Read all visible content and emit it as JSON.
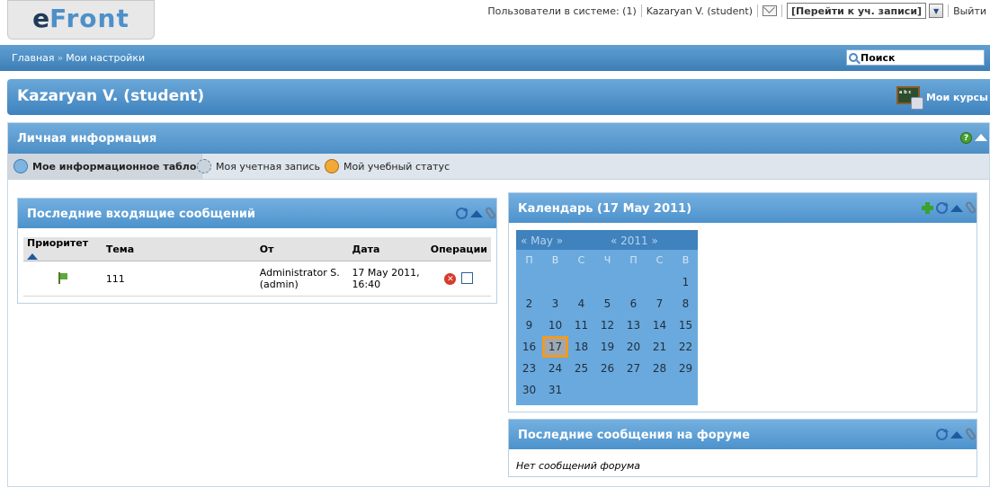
{
  "logo": {
    "e": "e",
    "front": "Front"
  },
  "topbar": {
    "users_online": "Пользователи в системе: (1)",
    "user": "Kazaryan V. (student)",
    "goto": "[Перейти к уч. записи]",
    "logout": "Выйти"
  },
  "navbar": {
    "home": "Главная",
    "arrow": "»",
    "settings": "Мои настройки",
    "search": "Поиск"
  },
  "userbar": {
    "name": "Kazaryan V. (student)",
    "my_courses": "Мои курсы"
  },
  "panel": {
    "title": "Личная информация",
    "tabs": [
      {
        "label": "Мое информационное табло"
      },
      {
        "label": "Моя учетная запись"
      },
      {
        "label": "Мой учебный статус"
      }
    ]
  },
  "inbox": {
    "title": "Последние входящие сообщений",
    "headers": {
      "priority": "Приоритет",
      "subject": "Тема",
      "from": "От",
      "date": "Дата",
      "ops": "Операции"
    },
    "rows": [
      {
        "subject": "111",
        "from_line1": "Administrator S.",
        "from_line2": "(admin)",
        "date_line1": "17 May 2011,",
        "date_line2": "16:40"
      }
    ]
  },
  "calendar": {
    "title": "Календарь (17 May 2011)",
    "month": "« May »",
    "year": "« 2011 »",
    "weekdays": [
      "П",
      "В",
      "С",
      "Ч",
      "П",
      "С",
      "В"
    ],
    "today": "17"
  },
  "forum": {
    "title": "Последние сообщения на форуме",
    "empty": "Нет сообщений форума"
  },
  "colors": {
    "accent": "#4d92cc",
    "today_border": "#f39a1e"
  }
}
